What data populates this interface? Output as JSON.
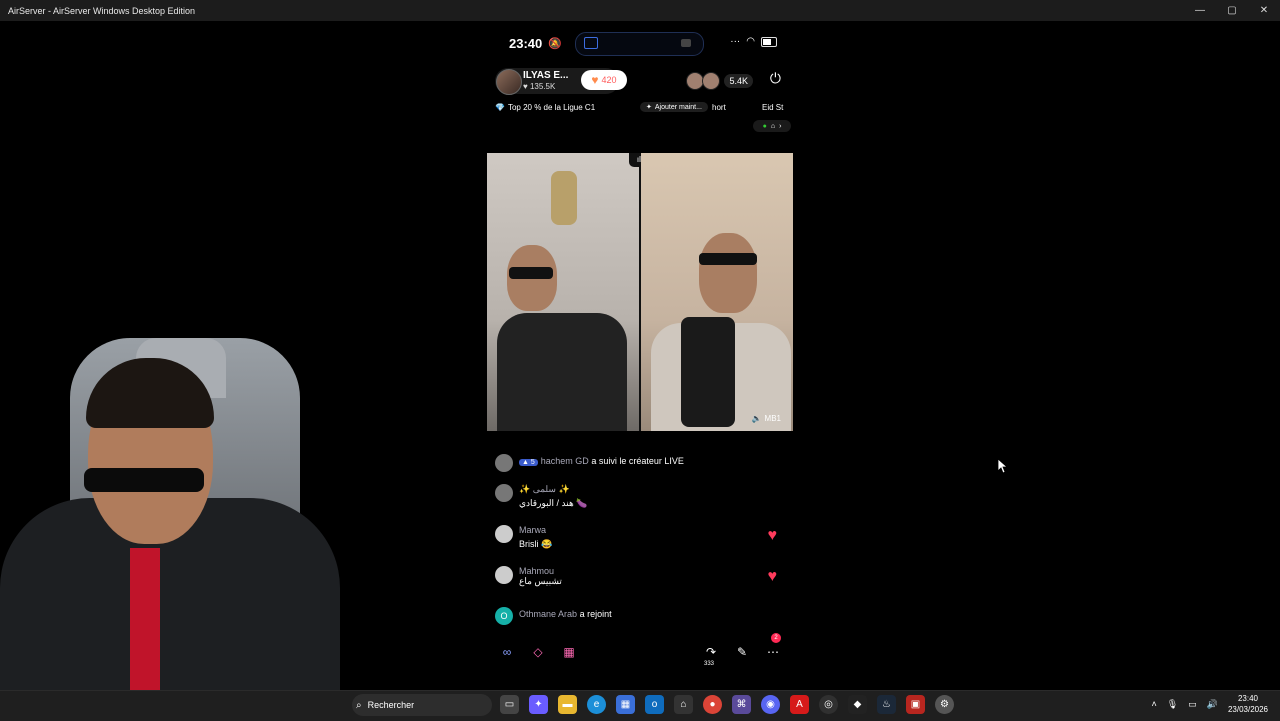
{
  "window": {
    "title": "AirServer - AirServer Windows Desktop Edition",
    "minimize": "—",
    "maximize": "▢",
    "close": "✕"
  },
  "status": {
    "time": "23:40",
    "bell_icon": "bell-mute-icon"
  },
  "host": {
    "name": "ILYAS E...",
    "likes": "135.5K",
    "heart_count": "420",
    "viewer_count": "5.4K"
  },
  "badges": {
    "league": "Top 20 % de la Ligue C1",
    "add_now": "Ajouter maint...",
    "short": "hort",
    "eid": "Eid St"
  },
  "video": {
    "right_tag": "MB1"
  },
  "chat": [
    {
      "type": "follow",
      "level": "5",
      "user": "hachem GD",
      "text": "a suivi le créateur LIVE"
    },
    {
      "type": "comment",
      "user": "✨ سلمى ✨",
      "text": "هند / البورقادي 🍆"
    },
    {
      "type": "comment",
      "user": "Marwa",
      "text": "Brisli 😂",
      "heart": true
    },
    {
      "type": "comment",
      "user": "Mahmou",
      "text": "تشبيس ماع",
      "heart": true
    },
    {
      "type": "join",
      "initial": "O",
      "user": "Othmane Arab",
      "text": "a rejoint"
    }
  ],
  "bottombar": {
    "share_count": "333",
    "more_badge": "2"
  },
  "taskbar": {
    "search_placeholder": "Rechercher",
    "time": "23:40",
    "date": "23/03/2026"
  }
}
